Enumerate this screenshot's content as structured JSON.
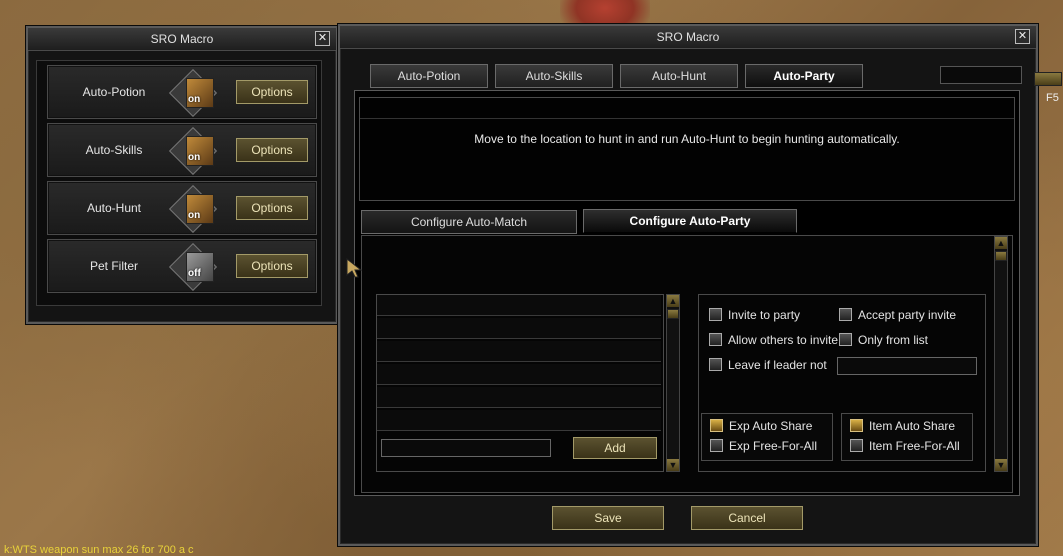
{
  "left_window": {
    "title": "SRO Macro",
    "close": "✕",
    "features": [
      {
        "label": "Auto-Potion",
        "state": "on",
        "button": "Options",
        "icon": "potion-icon"
      },
      {
        "label": "Auto-Skills",
        "state": "on",
        "button": "Options",
        "icon": "skills-icon"
      },
      {
        "label": "Auto-Hunt",
        "state": "on",
        "button": "Options",
        "icon": "hunt-icon"
      },
      {
        "label": "Pet Filter",
        "state": "off",
        "button": "Options",
        "icon": "pet-filter-icon"
      }
    ]
  },
  "right_window": {
    "title": "SRO Macro",
    "close": "✕",
    "tabs": [
      "Auto-Potion",
      "Auto-Skills",
      "Auto-Hunt",
      "Auto-Party"
    ],
    "active_tab": "Auto-Party",
    "description": "Move to the location to hunt in and run Auto-Hunt to begin hunting automatically.",
    "sub_tabs": [
      "Configure Auto-Match",
      "Configure Auto-Party"
    ],
    "active_sub_tab": "Configure Auto-Party",
    "add_button": "Add",
    "options": {
      "invite_to_party": "Invite to party",
      "accept_party_invite": "Accept party invite",
      "allow_others_to_invite": "Allow others to invite",
      "only_from_list": "Only from list",
      "leave_if_leader_not": "Leave if leader not",
      "exp_auto_share": "Exp Auto Share",
      "exp_free_for_all": "Exp Free-For-All",
      "item_auto_share": "Item Auto Share",
      "item_free_for_all": "Item Free-For-All"
    },
    "checked": {
      "exp_auto_share": true,
      "item_auto_share": true
    },
    "save_button": "Save",
    "cancel_button": "Cancel"
  },
  "side": {
    "label": "F5"
  },
  "chat": "k:WTS weapon sun max 26 for 700 a c",
  "colors": {
    "accent": "#a39a68",
    "button_text": "#ece3b8",
    "chat": "#e8d23a"
  }
}
